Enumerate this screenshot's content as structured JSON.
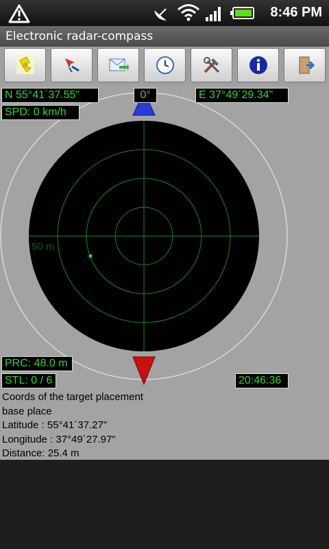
{
  "status_bar": {
    "time": "8:46 PM",
    "icons": [
      "alert-triangle-icon",
      "satellite-dish-icon",
      "wifi-icon",
      "signal-icon",
      "battery-icon"
    ]
  },
  "app": {
    "title": "Electronic radar-compass"
  },
  "toolbar": {
    "buttons": [
      {
        "name": "satellite-tool-button",
        "icon": "satellite-icon"
      },
      {
        "name": "target-tool-button",
        "icon": "pointer-icon"
      },
      {
        "name": "send-tool-button",
        "icon": "message-send-icon"
      },
      {
        "name": "clock-tool-button",
        "icon": "clock-icon"
      },
      {
        "name": "settings-tool-button",
        "icon": "tools-icon"
      },
      {
        "name": "info-tool-button",
        "icon": "info-icon"
      },
      {
        "name": "exit-tool-button",
        "icon": "exit-door-icon"
      }
    ]
  },
  "readouts": {
    "north": "N 55°41´37.55\"",
    "heading": "0°",
    "east": "E 37°49´29.34\"",
    "speed": "SPD:  0 km/h",
    "precision": "PRC: 48.0 m",
    "satellites": "STL: 0 / 6",
    "clock": "20:46:36"
  },
  "radar": {
    "range_label": "50 m",
    "colors": {
      "screen": "#000000",
      "grid": "#1a8a1a",
      "target": "#22dd22",
      "north": "#2a3cd8",
      "south": "#c81010"
    }
  },
  "info_text": {
    "line1": "Coords of the target placement",
    "line2": "base place",
    "line3": "Latitude : 55°41´37.27\"",
    "line4": "Longitude : 37°49´27.97\"",
    "line5": "Distance: 25.4 m"
  }
}
